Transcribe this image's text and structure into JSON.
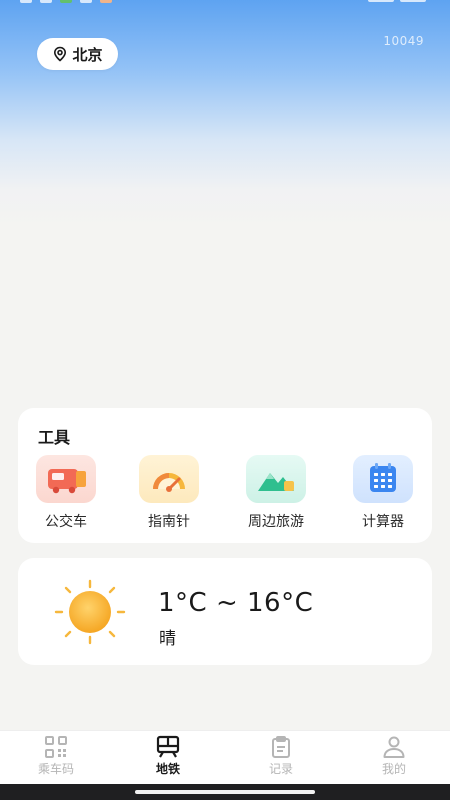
{
  "location": {
    "city": "北京"
  },
  "code_text": "10049",
  "tools": {
    "title": "工具",
    "items": [
      {
        "label": "公交车",
        "icon": "bus-icon"
      },
      {
        "label": "指南针",
        "icon": "compass-icon"
      },
      {
        "label": "周边旅游",
        "icon": "mountain-icon"
      },
      {
        "label": "计算器",
        "icon": "calculator-icon"
      }
    ]
  },
  "weather": {
    "temp_range": "1°C ~ 16°C",
    "condition": "晴",
    "icon": "sun-icon"
  },
  "tabs": [
    {
      "label": "乘车码",
      "icon": "qr-code-icon",
      "active": false
    },
    {
      "label": "地铁",
      "icon": "subway-icon",
      "active": true
    },
    {
      "label": "记录",
      "icon": "clipboard-icon",
      "active": false
    },
    {
      "label": "我的",
      "icon": "person-icon",
      "active": false
    }
  ],
  "colors": {
    "accent": "#2f7be8",
    "sun": "#f6b73c",
    "tab_inactive": "#b5b5b5"
  }
}
